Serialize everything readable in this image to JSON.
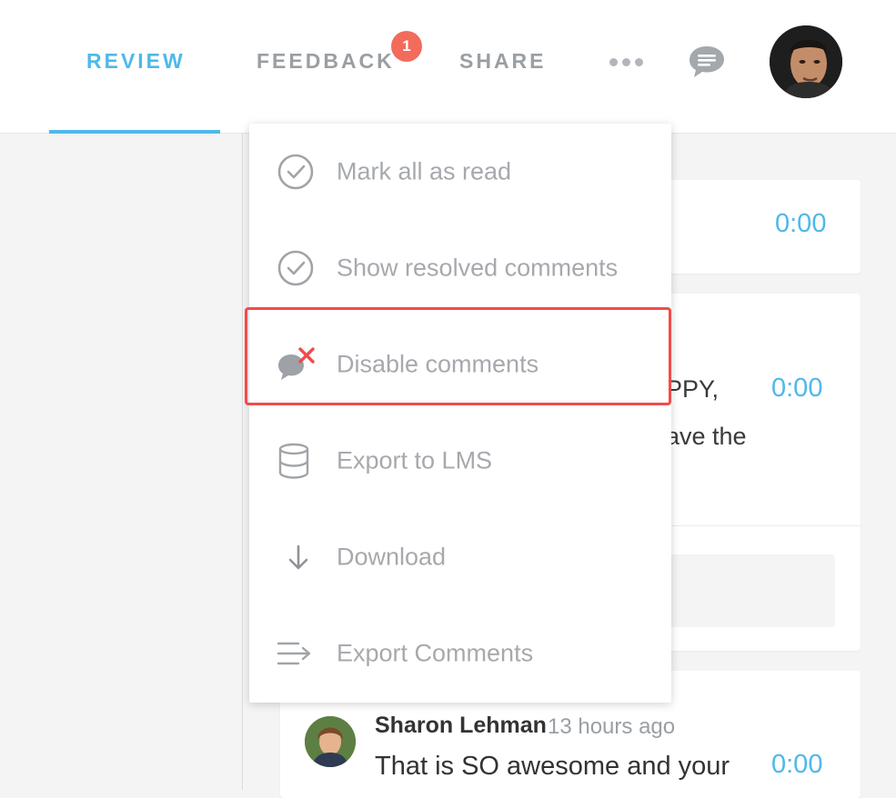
{
  "tabs": [
    {
      "label": "REVIEW",
      "active": true
    },
    {
      "label": "FEEDBACK",
      "badge": "1"
    },
    {
      "label": "SHARE"
    }
  ],
  "header_icons": {
    "more": "more-horizontal-icon",
    "comments": "chat-bubble-icon",
    "avatar": "user-avatar"
  },
  "colors": {
    "accent": "#4fb8ea",
    "badge": "#f26b5b",
    "highlight": "#f24b4b",
    "muted_text": "#a6a9ad"
  },
  "menu": {
    "items": [
      {
        "label": "Mark all as read",
        "icon": "check-circle-icon"
      },
      {
        "label": "Show resolved comments",
        "icon": "check-circle-icon"
      },
      {
        "label": "Disable comments",
        "icon": "disable-comments-icon",
        "highlighted": true
      },
      {
        "label": "Export to LMS",
        "icon": "database-icon"
      },
      {
        "label": "Download",
        "icon": "arrow-down-icon"
      },
      {
        "label": "Export Comments",
        "icon": "export-lines-icon"
      }
    ]
  },
  "background_cards": {
    "card1": {
      "time": "0:00"
    },
    "card2": {
      "time": "0:00",
      "text_line1": "PPY,",
      "text_line2": "ave the"
    }
  },
  "comment": {
    "author": "Sharon Lehman",
    "time_ago": "13 hours ago",
    "text": "That is SO awesome and your",
    "time": "0:00"
  }
}
